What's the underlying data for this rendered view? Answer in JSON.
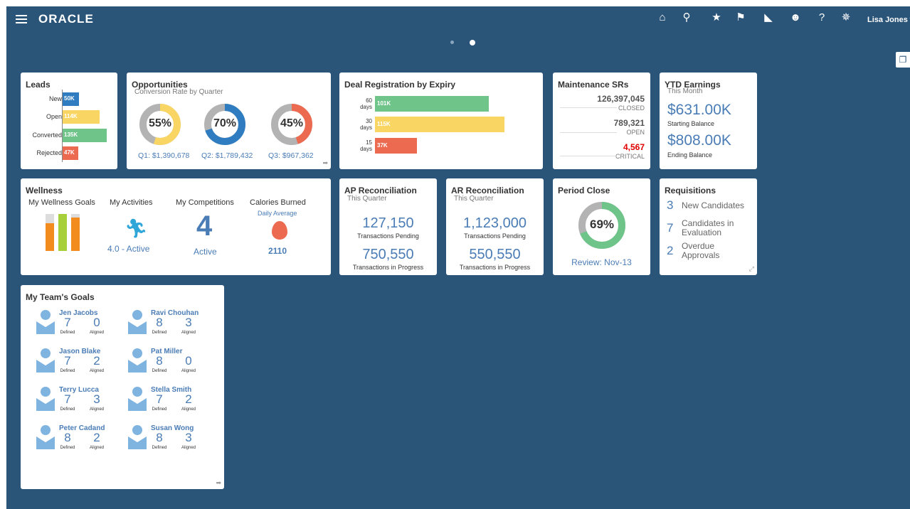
{
  "header": {
    "logo": "ORACLE",
    "user": "Lisa Jones ▾",
    "icons": [
      "home-icon",
      "search-icon",
      "star-icon",
      "flag-icon",
      "bell-icon",
      "accessibility-icon",
      "help-icon",
      "gear-icon"
    ]
  },
  "leads": {
    "title": "Leads",
    "rows": [
      {
        "label": "New",
        "value": "50K",
        "amount": 50,
        "color": "#2f7dc0"
      },
      {
        "label": "Open",
        "value": "114K",
        "amount": 114,
        "color": "#f9d664"
      },
      {
        "label": "Converted",
        "value": "135K",
        "amount": 135,
        "color": "#6fc48a"
      },
      {
        "label": "Rejected",
        "value": "47K",
        "amount": 47,
        "color": "#ec6a50"
      }
    ]
  },
  "opportunities": {
    "title": "Opportunities",
    "subtitle": "Conversion Rate by Quarter",
    "donuts": [
      {
        "pct": "55%",
        "value": 55,
        "label": "Q1: $1,390,678",
        "color": "#f9d664"
      },
      {
        "pct": "70%",
        "value": 70,
        "label": "Q2: $1,789,432",
        "color": "#2f7dc0"
      },
      {
        "pct": "45%",
        "value": 45,
        "label": "Q3: $967,362",
        "color": "#ec6a50"
      }
    ]
  },
  "deal_registration": {
    "title": "Deal Registration by Expiry",
    "rows": [
      {
        "days_num": "60",
        "days_word": "days",
        "value": "101K",
        "amount": 101,
        "color": "#6fc48a"
      },
      {
        "days_num": "30",
        "days_word": "days",
        "value": "115K",
        "amount": 115,
        "color": "#f9d664"
      },
      {
        "days_num": "15",
        "days_word": "days",
        "value": "37K",
        "amount": 37,
        "color": "#ec6a50"
      }
    ]
  },
  "maintenance": {
    "title": "Maintenance SRs",
    "closed_value": "126,397,045",
    "closed_label": "CLOSED",
    "open_value": "789,321",
    "open_label": "OPEN",
    "critical_value": "4,567",
    "critical_label": "CRITICAL"
  },
  "ytd": {
    "title": "YTD Earnings",
    "subtitle": "This Month",
    "starting_value": "$631.00K",
    "starting_label": "Starting Balance",
    "ending_value": "$808.00K",
    "ending_label": "Ending Balance"
  },
  "wellness": {
    "title": "Wellness",
    "goals_title": "My Wellness Goals",
    "activities_title": "My Activities",
    "activities_value": "4.0 - Active",
    "competitions_title": "My Competitions",
    "competitions_value": "4",
    "competitions_label": "Active",
    "calories_title": "Calories Burned",
    "calories_sub": "Daily Average",
    "calories_value": "2110",
    "goal_levels": [
      0.75,
      1.0,
      0.9
    ],
    "goal_colors": [
      "#f28c1e",
      "#a6cf3a",
      "#f28c1e"
    ]
  },
  "ap": {
    "title": "AP Reconciliation",
    "subtitle": "This Quarter",
    "pending_value": "127,150",
    "pending_label": "Transactions Pending",
    "progress_value": "750,550",
    "progress_label": "Transactions in Progress"
  },
  "ar": {
    "title": "AR Reconciliation",
    "subtitle": "This Quarter",
    "pending_value": "1,123,000",
    "pending_label": "Transactions Pending",
    "progress_value": "550,550",
    "progress_label": "Transactions in Progress"
  },
  "period_close": {
    "title": "Period Close",
    "pct": "69%",
    "value": 69,
    "color": "#6fc48a",
    "review": "Review: Nov-13"
  },
  "requisitions": {
    "title": "Requisitions",
    "items": [
      {
        "num": "3",
        "line1": "New Candidates",
        "line2": ""
      },
      {
        "num": "7",
        "line1": "Candidates in",
        "line2": "Evaluation"
      },
      {
        "num": "2",
        "line1": "Overdue",
        "line2": "Approvals"
      }
    ]
  },
  "team": {
    "title": "My Team's Goals",
    "defined_label": "Defined",
    "aligned_label": "Aligned",
    "members": [
      {
        "name": "Jen Jacobs",
        "defined": "7",
        "aligned": "0"
      },
      {
        "name": "Ravi Chouhan",
        "defined": "8",
        "aligned": "3"
      },
      {
        "name": "Jason Blake",
        "defined": "7",
        "aligned": "2"
      },
      {
        "name": "Pat Miller",
        "defined": "8",
        "aligned": "0"
      },
      {
        "name": "Terry Lucca",
        "defined": "7",
        "aligned": "3"
      },
      {
        "name": "Stella Smith",
        "defined": "7",
        "aligned": "2"
      },
      {
        "name": "Peter Cadand",
        "defined": "8",
        "aligned": "2"
      },
      {
        "name": "Susan Wong",
        "defined": "8",
        "aligned": "3"
      }
    ]
  }
}
